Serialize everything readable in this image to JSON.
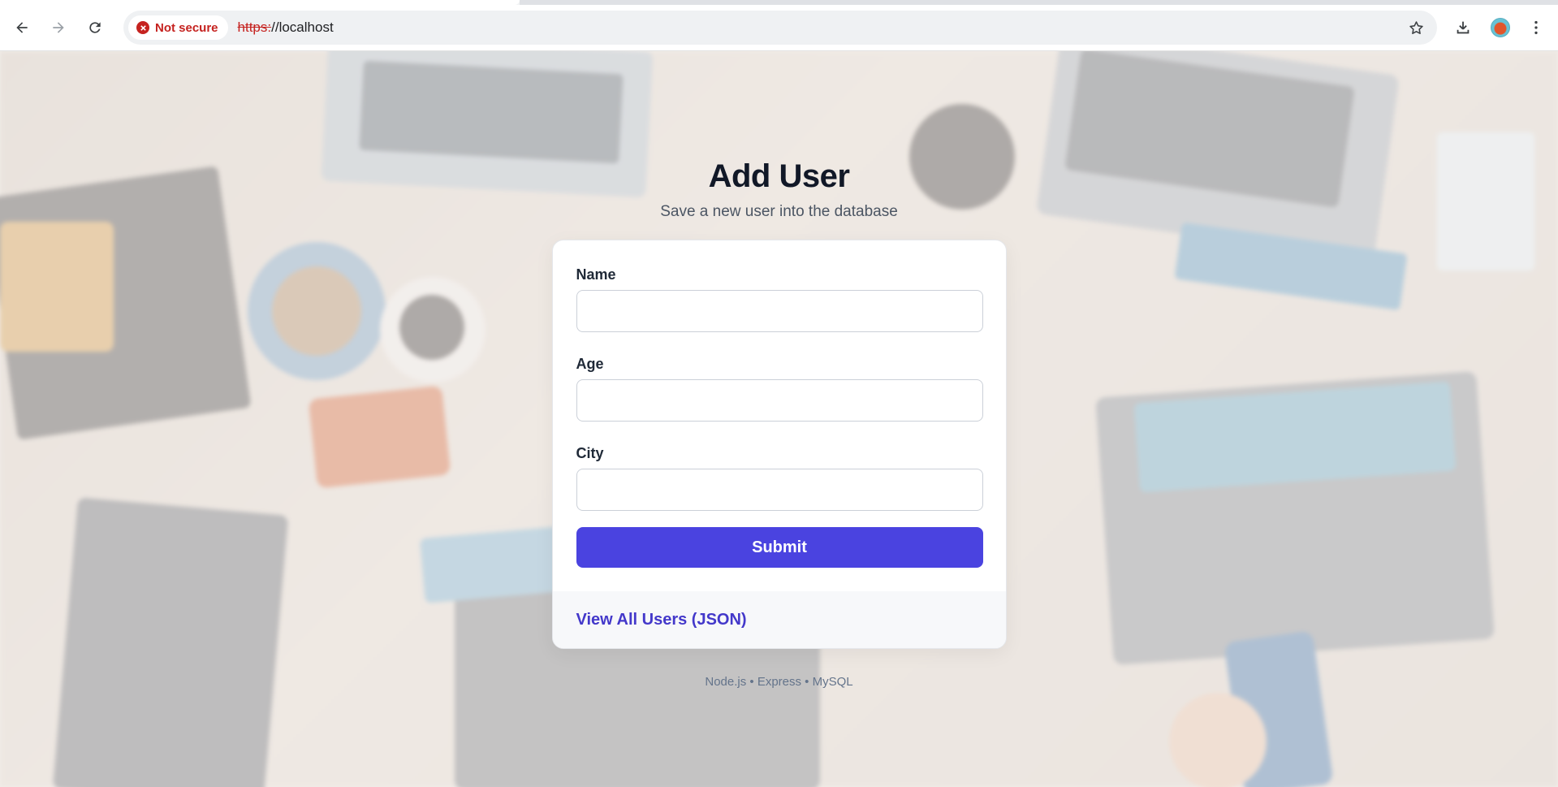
{
  "browser": {
    "security_chip": "Not secure",
    "url_scheme": "https:",
    "url_rest": "//localhost",
    "icons": [
      "back-icon",
      "forward-icon",
      "reload-icon",
      "not-secure-icon",
      "star-icon",
      "download-icon",
      "profile-avatar",
      "menu-icon"
    ],
    "accent_color": "#c5221f"
  },
  "page": {
    "title": "Add User",
    "subtitle": "Save a new user into the database",
    "form": {
      "name_label": "Name",
      "name_value": "",
      "age_label": "Age",
      "age_value": "",
      "city_label": "City",
      "city_value": "",
      "submit_label": "Submit"
    },
    "link_label": "View All Users (JSON)",
    "footer": "Node.js • Express • MySQL",
    "colors": {
      "primary": "#4a43e0",
      "link": "#4338ca",
      "title": "#111827"
    }
  }
}
